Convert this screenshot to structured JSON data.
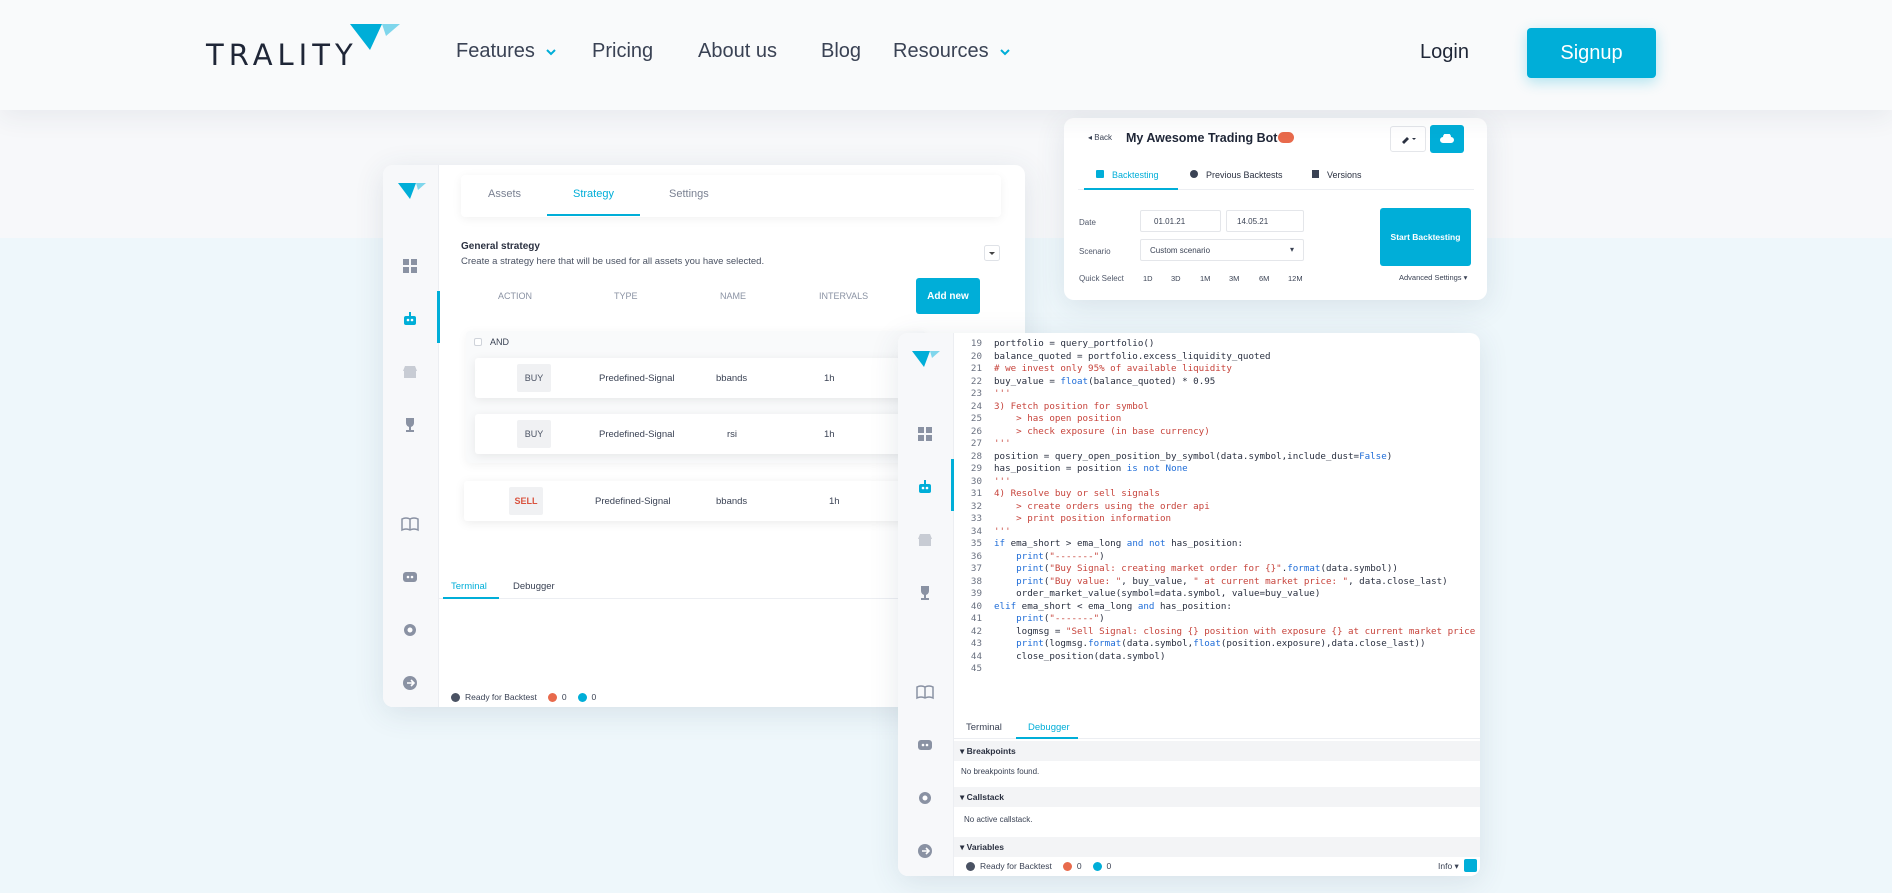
{
  "nav": {
    "logo": "TRALITY",
    "items": [
      {
        "label": "Features",
        "dropdown": true
      },
      {
        "label": "Pricing",
        "dropdown": false
      },
      {
        "label": "About us",
        "dropdown": false
      },
      {
        "label": "Blog",
        "dropdown": false
      },
      {
        "label": "Resources",
        "dropdown": true
      }
    ],
    "login": "Login",
    "signup": "Signup",
    "accent": "#00aed8"
  },
  "strategy": {
    "tabs": [
      "Assets",
      "Strategy",
      "Settings"
    ],
    "active_tab": "Strategy",
    "heading": "General strategy",
    "subheading": "Create a strategy here that will be used for all assets you have selected.",
    "columns": [
      "ACTION",
      "TYPE",
      "NAME",
      "INTERVALS"
    ],
    "add_new": "Add new",
    "group": "AND",
    "rows": [
      {
        "action": "BUY",
        "type": "Predefined-Signal",
        "name": "bbands",
        "interval": "1h"
      },
      {
        "action": "BUY",
        "type": "Predefined-Signal",
        "name": "rsi",
        "interval": "1h"
      },
      {
        "action": "SELL",
        "type": "Predefined-Signal",
        "name": "bbands",
        "interval": "1h"
      }
    ],
    "bottom_tabs": [
      "Terminal",
      "Debugger"
    ],
    "status": "Ready for Backtest",
    "errors": "0",
    "infos": "0"
  },
  "backtest": {
    "back": "Back",
    "title": "My Awesome Trading Bot",
    "tabs": [
      "Backtesting",
      "Previous Backtests",
      "Versions"
    ],
    "date_label": "Date",
    "date_from": "01.01.21",
    "date_to": "14.05.21",
    "scenario_label": "Scenario",
    "scenario_value": "Custom scenario",
    "quick_select_label": "Quick Select",
    "quick_select": [
      "1D",
      "3D",
      "1M",
      "3M",
      "6M",
      "12M"
    ],
    "advanced": "Advanced Settings",
    "start": "Start Backtesting"
  },
  "editor": {
    "lines": [
      {
        "n": "19",
        "t": "portfolio = query_portfolio()"
      },
      {
        "n": "20",
        "t": "balance_quoted = portfolio.excess_liquidity_quoted"
      },
      {
        "n": "21",
        "t": "# we invest only 95% of available liquidity"
      },
      {
        "n": "22",
        "t": "buy_value = float(balance_quoted) * 0.95"
      },
      {
        "n": "23",
        "t": "'''"
      },
      {
        "n": "24",
        "t": "3) Fetch position for symbol"
      },
      {
        "n": "25",
        "t": "    > has open position"
      },
      {
        "n": "26",
        "t": "    > check exposure (in base currency)"
      },
      {
        "n": "27",
        "t": "'''"
      },
      {
        "n": "28",
        "t": "position = query_open_position_by_symbol(data.symbol,include_dust=False)"
      },
      {
        "n": "29",
        "t": "has_position = position is not None"
      },
      {
        "n": "30",
        "t": "'''"
      },
      {
        "n": "31",
        "t": "4) Resolve buy or sell signals"
      },
      {
        "n": "32",
        "t": "    > create orders using the order api"
      },
      {
        "n": "33",
        "t": "    > print position information"
      },
      {
        "n": "34",
        "t": "'''"
      },
      {
        "n": "35",
        "t": "if ema_short > ema_long and not has_position:"
      },
      {
        "n": "36",
        "t": "    print(\"-------\")"
      },
      {
        "n": "37",
        "t": "    print(\"Buy Signal: creating market order for {}\".format(data.symbol))"
      },
      {
        "n": "38",
        "t": "    print(\"Buy value: \", buy_value, \" at current market price: \", data.close_last)"
      },
      {
        "n": "39",
        "t": "    order_market_value(symbol=data.symbol, value=buy_value)"
      },
      {
        "n": "40",
        "t": "elif ema_short < ema_long and has_position:"
      },
      {
        "n": "41",
        "t": "    print(\"-------\")"
      },
      {
        "n": "42",
        "t": "    logmsg = \"Sell Signal: closing {} position with exposure {} at current market price {}\""
      },
      {
        "n": "43",
        "t": "    print(logmsg.format(data.symbol,float(position.exposure),data.close_last))"
      },
      {
        "n": "44",
        "t": "    close_position(data.symbol)"
      },
      {
        "n": "45",
        "t": ""
      }
    ],
    "bottom_tabs": [
      "Terminal",
      "Debugger"
    ],
    "active_bottom_tab": "Debugger",
    "sections": [
      {
        "title": "Breakpoints",
        "empty": "No breakpoints found."
      },
      {
        "title": "Callstack",
        "empty": "No active callstack."
      },
      {
        "title": "Variables",
        "empty": ""
      }
    ],
    "status": "Ready for Backtest",
    "errors": "0",
    "infos": "0",
    "level": "Info"
  }
}
